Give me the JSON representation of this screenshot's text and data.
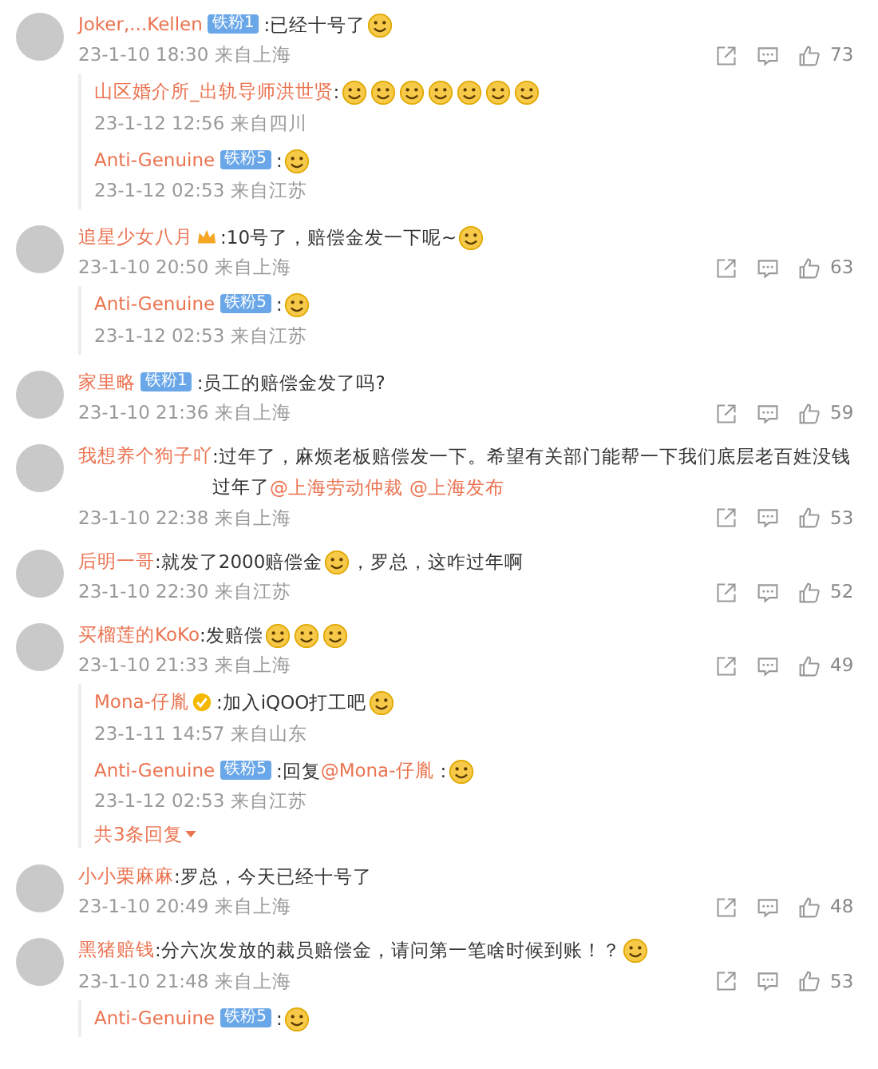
{
  "comments": [
    {
      "name": "Joker,...Kellen",
      "badge": {
        "kind": "fan",
        "label": "铁粉1"
      },
      "content": [
        {
          "kind": "text",
          "text": ":已经十号了"
        },
        {
          "kind": "emoji"
        }
      ],
      "time": "23-1-10 18:30 来自上海",
      "likes": "73",
      "replies": [
        {
          "name": "山区婚介所_出轨导师洪世贤",
          "content": [
            {
              "kind": "text",
              "text": ":"
            },
            {
              "kind": "emoji"
            },
            {
              "kind": "emoji"
            },
            {
              "kind": "emoji"
            },
            {
              "kind": "emoji"
            },
            {
              "kind": "emoji"
            },
            {
              "kind": "emoji"
            },
            {
              "kind": "emoji"
            }
          ],
          "time": "23-1-12 12:56 来自四川"
        },
        {
          "name": "Anti-Genuine",
          "badge": {
            "kind": "fan",
            "label": "铁粉5"
          },
          "content": [
            {
              "kind": "text",
              "text": ":"
            },
            {
              "kind": "emoji"
            }
          ],
          "time": "23-1-12 02:53 来自江苏"
        }
      ]
    },
    {
      "name": "追星少女八月",
      "badge": {
        "kind": "crown"
      },
      "content": [
        {
          "kind": "text",
          "text": ":10号了，赔偿金发一下呢~"
        },
        {
          "kind": "emoji"
        }
      ],
      "time": "23-1-10 20:50 来自上海",
      "likes": "63",
      "replies": [
        {
          "name": "Anti-Genuine",
          "badge": {
            "kind": "fan",
            "label": "铁粉5"
          },
          "content": [
            {
              "kind": "text",
              "text": ":"
            },
            {
              "kind": "emoji"
            }
          ],
          "time": "23-1-12 02:53 来自江苏"
        }
      ]
    },
    {
      "name": "家里略",
      "badge": {
        "kind": "fan",
        "label": "铁粉1"
      },
      "content": [
        {
          "kind": "text",
          "text": ":员工的赔偿金发了吗?"
        }
      ],
      "time": "23-1-10 21:36 来自上海",
      "likes": "59"
    },
    {
      "name": "我想养个狗子吖",
      "content": [
        {
          "kind": "text",
          "text": ":过年了，麻烦老板赔偿发一下。希望有关部门能帮一下我们底层老百姓没钱过年了"
        },
        {
          "kind": "mention",
          "text": "@上海劳动仲裁"
        },
        {
          "kind": "mention",
          "text": "@上海发布"
        }
      ],
      "time": "23-1-10 22:38 来自上海",
      "likes": "53"
    },
    {
      "name": "后明一哥",
      "content": [
        {
          "kind": "text",
          "text": ":就发了2000赔偿金"
        },
        {
          "kind": "emoji"
        },
        {
          "kind": "text",
          "text": "，罗总，这咋过年啊"
        }
      ],
      "time": "23-1-10 22:30 来自江苏",
      "likes": "52"
    },
    {
      "name": "买榴莲的KoKo",
      "content": [
        {
          "kind": "text",
          "text": ":发赔偿"
        },
        {
          "kind": "emoji"
        },
        {
          "kind": "emoji"
        },
        {
          "kind": "emoji"
        }
      ],
      "time": "23-1-10 21:33 来自上海",
      "likes": "49",
      "replies": [
        {
          "name": "Mona-仔胤",
          "badge": {
            "kind": "verified"
          },
          "content": [
            {
              "kind": "text",
              "text": ":加入iQOO打工吧"
            },
            {
              "kind": "emoji"
            }
          ],
          "time": "23-1-11 14:57 来自山东"
        },
        {
          "name": "Anti-Genuine",
          "badge": {
            "kind": "fan",
            "label": "铁粉5"
          },
          "content": [
            {
              "kind": "text",
              "text": ":回复"
            },
            {
              "kind": "mention",
              "text": "@Mona-仔胤"
            },
            {
              "kind": "text",
              "text": ":"
            },
            {
              "kind": "emoji"
            }
          ],
          "time": "23-1-12 02:53 来自江苏"
        }
      ],
      "more_replies": "共3条回复"
    },
    {
      "name": "小小栗麻麻",
      "content": [
        {
          "kind": "text",
          "text": ":罗总，今天已经十号了"
        }
      ],
      "time": "23-1-10 20:49 来自上海",
      "likes": "48"
    },
    {
      "name": "黑猪赔钱",
      "content": [
        {
          "kind": "text",
          "text": ":分六次发放的裁员赔偿金，请问第一笔啥时候到账！？"
        },
        {
          "kind": "emoji"
        }
      ],
      "time": "23-1-10 21:48 来自上海",
      "likes": "53",
      "replies": [
        {
          "name": "Anti-Genuine",
          "badge": {
            "kind": "fan",
            "label": "铁粉5"
          },
          "content": [
            {
              "kind": "text",
              "text": ":"
            },
            {
              "kind": "emoji"
            }
          ]
        }
      ]
    }
  ]
}
